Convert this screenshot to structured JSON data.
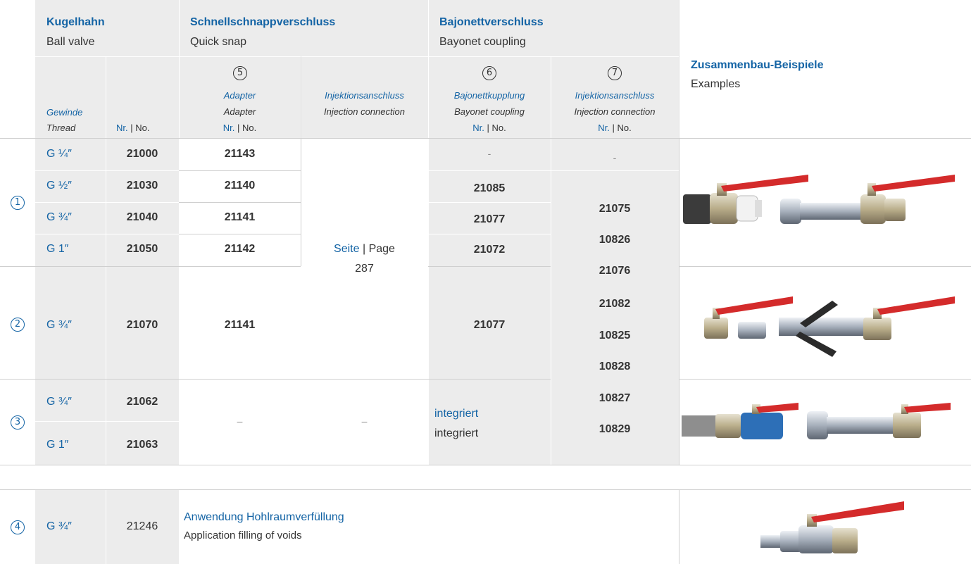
{
  "header": {
    "ball_valve": {
      "de": "Kugelhahn",
      "en": "Ball valve"
    },
    "quick_snap": {
      "de": "Schnellschnappverschluss",
      "en": "Quick snap"
    },
    "bayonet": {
      "de": "Bajonettverschluss",
      "en": "Bayonet coupling"
    },
    "examples": {
      "de": "Zusammenbau-Beispiele",
      "en": "Examples"
    }
  },
  "subheader": {
    "thread": {
      "de": "Gewinde",
      "en": "Thread"
    },
    "nr": {
      "de": "Nr.",
      "sep": "|",
      "en": "No."
    },
    "adapter": {
      "mark": "5",
      "de": "Adapter",
      "en": "Adapter"
    },
    "injection": {
      "de": "Injektionsanschluss",
      "en": "Injection connection"
    },
    "bayonet_coupling": {
      "mark": "6",
      "de": "Bajonettkupplung",
      "en": "Bayonet coupling"
    },
    "injection2": {
      "mark": "7",
      "de": "Injektionsanschluss",
      "en": "Injection connection"
    }
  },
  "groups": [
    {
      "mark": "1"
    },
    {
      "mark": "2"
    },
    {
      "mark": "3"
    },
    {
      "mark": "4"
    }
  ],
  "rows": [
    {
      "thread": "G ¼″",
      "nr": "21000",
      "adapter": "21143",
      "bayonet": "-",
      "injection": "-"
    },
    {
      "thread": "G ½″",
      "nr": "21030",
      "adapter": "21140",
      "bayonet": "21085"
    },
    {
      "thread": "G ¾″",
      "nr": "21040",
      "adapter": "21141",
      "bayonet": "21077"
    },
    {
      "thread": "G 1″",
      "nr": "21050",
      "adapter": "21142",
      "bayonet": "21072"
    },
    {
      "thread": "G ¾″",
      "nr": "21070",
      "adapter": "21141",
      "bayonet": "21077"
    },
    {
      "thread": "G ¾″",
      "nr": "21062"
    },
    {
      "thread": "G 1″",
      "nr": "21063"
    },
    {
      "thread": "G ¾″",
      "nr": "21246"
    }
  ],
  "group3": {
    "adapter": "–",
    "injection": "–",
    "bayonet_de": "integriert",
    "bayonet_en": "integriert"
  },
  "page_ref": {
    "de": "Seite",
    "sep": "|",
    "en": "Page",
    "number": "287"
  },
  "injection_numbers": [
    "21075",
    "10826",
    "21076",
    "21082",
    "10825",
    "10828",
    "10827",
    "10829"
  ],
  "application": {
    "de": "Anwendung Hohlraumverfüllung",
    "en": "Application filling of voids"
  },
  "colors": {
    "accent": "#1464a5",
    "panel": "#ececec",
    "handle": "#d42b2b"
  }
}
